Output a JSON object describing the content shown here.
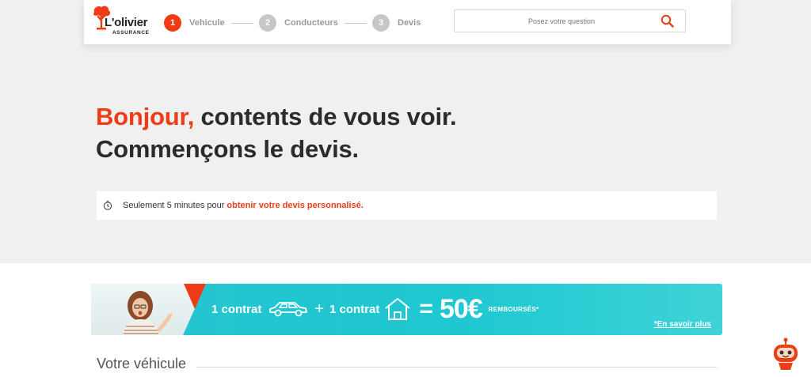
{
  "brand": {
    "name": "L'olivier",
    "tagline": "ASSURANCE",
    "accent": "#ef3b16"
  },
  "steps": [
    {
      "num": "1",
      "label": "Vehicule",
      "active": true
    },
    {
      "num": "2",
      "label": "Conducteurs",
      "active": false
    },
    {
      "num": "3",
      "label": "Devis",
      "active": false
    }
  ],
  "search": {
    "placeholder": "Posez votre question",
    "icon": "search-icon"
  },
  "hero": {
    "accent": "Bonjour,",
    "line1_rest": " contents de vous voir.",
    "line2": "Commençons le devis."
  },
  "info": {
    "icon": "clock-icon",
    "text": "Seulement 5 minutes pour",
    "highlight": "obtenir votre devis personnalisé."
  },
  "banner": {
    "contract1": "1 contrat",
    "plus": "+",
    "contract2": "1 contrat",
    "equals": "=",
    "amount": "50€",
    "refund": "REMBOURSÉS*",
    "link": "*En savoir plus"
  },
  "section": {
    "title": "Votre véhicule"
  },
  "chatbot": {
    "icon": "robot-icon"
  }
}
